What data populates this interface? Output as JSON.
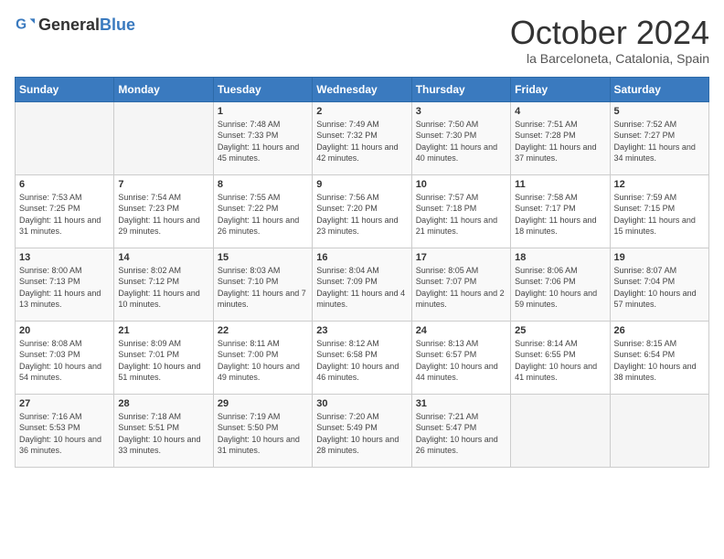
{
  "header": {
    "logo_general": "General",
    "logo_blue": "Blue",
    "month_title": "October 2024",
    "subtitle": "la Barceloneta, Catalonia, Spain"
  },
  "calendar": {
    "weekdays": [
      "Sunday",
      "Monday",
      "Tuesday",
      "Wednesday",
      "Thursday",
      "Friday",
      "Saturday"
    ],
    "weeks": [
      [
        {
          "day": "",
          "info": ""
        },
        {
          "day": "",
          "info": ""
        },
        {
          "day": "1",
          "info": "Sunrise: 7:48 AM\nSunset: 7:33 PM\nDaylight: 11 hours and 45 minutes."
        },
        {
          "day": "2",
          "info": "Sunrise: 7:49 AM\nSunset: 7:32 PM\nDaylight: 11 hours and 42 minutes."
        },
        {
          "day": "3",
          "info": "Sunrise: 7:50 AM\nSunset: 7:30 PM\nDaylight: 11 hours and 40 minutes."
        },
        {
          "day": "4",
          "info": "Sunrise: 7:51 AM\nSunset: 7:28 PM\nDaylight: 11 hours and 37 minutes."
        },
        {
          "day": "5",
          "info": "Sunrise: 7:52 AM\nSunset: 7:27 PM\nDaylight: 11 hours and 34 minutes."
        }
      ],
      [
        {
          "day": "6",
          "info": "Sunrise: 7:53 AM\nSunset: 7:25 PM\nDaylight: 11 hours and 31 minutes."
        },
        {
          "day": "7",
          "info": "Sunrise: 7:54 AM\nSunset: 7:23 PM\nDaylight: 11 hours and 29 minutes."
        },
        {
          "day": "8",
          "info": "Sunrise: 7:55 AM\nSunset: 7:22 PM\nDaylight: 11 hours and 26 minutes."
        },
        {
          "day": "9",
          "info": "Sunrise: 7:56 AM\nSunset: 7:20 PM\nDaylight: 11 hours and 23 minutes."
        },
        {
          "day": "10",
          "info": "Sunrise: 7:57 AM\nSunset: 7:18 PM\nDaylight: 11 hours and 21 minutes."
        },
        {
          "day": "11",
          "info": "Sunrise: 7:58 AM\nSunset: 7:17 PM\nDaylight: 11 hours and 18 minutes."
        },
        {
          "day": "12",
          "info": "Sunrise: 7:59 AM\nSunset: 7:15 PM\nDaylight: 11 hours and 15 minutes."
        }
      ],
      [
        {
          "day": "13",
          "info": "Sunrise: 8:00 AM\nSunset: 7:13 PM\nDaylight: 11 hours and 13 minutes."
        },
        {
          "day": "14",
          "info": "Sunrise: 8:02 AM\nSunset: 7:12 PM\nDaylight: 11 hours and 10 minutes."
        },
        {
          "day": "15",
          "info": "Sunrise: 8:03 AM\nSunset: 7:10 PM\nDaylight: 11 hours and 7 minutes."
        },
        {
          "day": "16",
          "info": "Sunrise: 8:04 AM\nSunset: 7:09 PM\nDaylight: 11 hours and 4 minutes."
        },
        {
          "day": "17",
          "info": "Sunrise: 8:05 AM\nSunset: 7:07 PM\nDaylight: 11 hours and 2 minutes."
        },
        {
          "day": "18",
          "info": "Sunrise: 8:06 AM\nSunset: 7:06 PM\nDaylight: 10 hours and 59 minutes."
        },
        {
          "day": "19",
          "info": "Sunrise: 8:07 AM\nSunset: 7:04 PM\nDaylight: 10 hours and 57 minutes."
        }
      ],
      [
        {
          "day": "20",
          "info": "Sunrise: 8:08 AM\nSunset: 7:03 PM\nDaylight: 10 hours and 54 minutes."
        },
        {
          "day": "21",
          "info": "Sunrise: 8:09 AM\nSunset: 7:01 PM\nDaylight: 10 hours and 51 minutes."
        },
        {
          "day": "22",
          "info": "Sunrise: 8:11 AM\nSunset: 7:00 PM\nDaylight: 10 hours and 49 minutes."
        },
        {
          "day": "23",
          "info": "Sunrise: 8:12 AM\nSunset: 6:58 PM\nDaylight: 10 hours and 46 minutes."
        },
        {
          "day": "24",
          "info": "Sunrise: 8:13 AM\nSunset: 6:57 PM\nDaylight: 10 hours and 44 minutes."
        },
        {
          "day": "25",
          "info": "Sunrise: 8:14 AM\nSunset: 6:55 PM\nDaylight: 10 hours and 41 minutes."
        },
        {
          "day": "26",
          "info": "Sunrise: 8:15 AM\nSunset: 6:54 PM\nDaylight: 10 hours and 38 minutes."
        }
      ],
      [
        {
          "day": "27",
          "info": "Sunrise: 7:16 AM\nSunset: 5:53 PM\nDaylight: 10 hours and 36 minutes."
        },
        {
          "day": "28",
          "info": "Sunrise: 7:18 AM\nSunset: 5:51 PM\nDaylight: 10 hours and 33 minutes."
        },
        {
          "day": "29",
          "info": "Sunrise: 7:19 AM\nSunset: 5:50 PM\nDaylight: 10 hours and 31 minutes."
        },
        {
          "day": "30",
          "info": "Sunrise: 7:20 AM\nSunset: 5:49 PM\nDaylight: 10 hours and 28 minutes."
        },
        {
          "day": "31",
          "info": "Sunrise: 7:21 AM\nSunset: 5:47 PM\nDaylight: 10 hours and 26 minutes."
        },
        {
          "day": "",
          "info": ""
        },
        {
          "day": "",
          "info": ""
        }
      ]
    ]
  }
}
